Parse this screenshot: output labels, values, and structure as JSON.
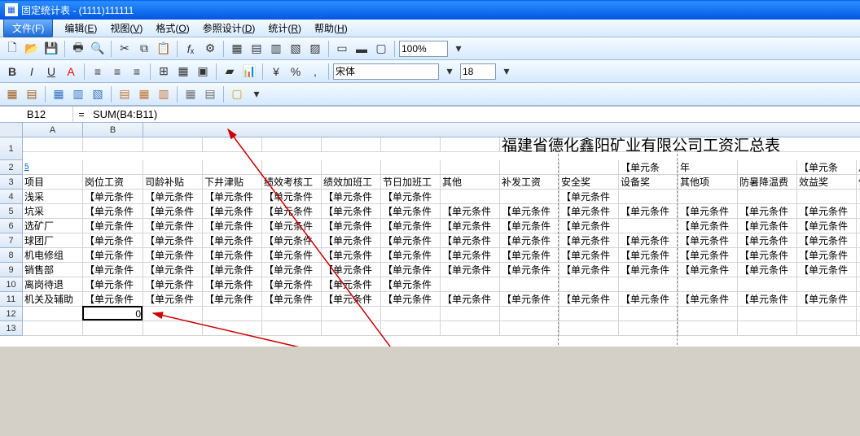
{
  "window": {
    "title": "固定统计表 - (1111)111111"
  },
  "menu": {
    "file": "文件(F)",
    "items": [
      {
        "label": "编辑",
        "key": "E"
      },
      {
        "label": "视图",
        "key": "V"
      },
      {
        "label": "格式",
        "key": "O"
      },
      {
        "label": "参照设计",
        "key": "D"
      },
      {
        "label": "统计",
        "key": "R"
      },
      {
        "label": "帮助",
        "key": "H"
      }
    ]
  },
  "formulaBar": {
    "cellRef": "B12",
    "formula": "SUM(B4:B11)"
  },
  "toolbar2": {
    "zoom": "100%",
    "font": "宋体",
    "fontSize": "18"
  },
  "sheet": {
    "colLetters": [
      "A",
      "B"
    ],
    "colWidths": {
      "A": 74,
      "B": 74,
      "rest": 73
    },
    "rowNumbers": [
      "1",
      "2",
      "3",
      "4",
      "5",
      "6",
      "7",
      "8",
      "9",
      "10",
      "11",
      "12",
      "13"
    ],
    "title": "福建省德化鑫阳矿业有限公司工资汇总表",
    "row2": {
      "K": "【单元条",
      "L": "年",
      "N": "【单元条",
      "O": "月"
    },
    "headerRow": [
      "项目",
      "岗位工资",
      "司龄补贴",
      "下井津贴",
      "绩效考核工",
      "绩效加班工",
      "节日加班工",
      "其他",
      "补发工资",
      "安全奖",
      "设备奖",
      "其他项",
      "防暑降温费",
      "效益奖",
      "停"
    ],
    "rowLabels": [
      "浅采",
      "坑采",
      "选矿厂",
      "球团厂",
      "机电修组",
      "销售部",
      "离岗待退",
      "机关及辅助"
    ],
    "placeholder": "【单元条件",
    "extraCellA2": "5",
    "b12": "0",
    "fillPattern": {
      "cols": 14,
      "blanks": {
        "4": [
          6,
          7,
          9,
          10,
          11,
          12,
          13
        ],
        "5": [
          13
        ],
        "6": [
          9
        ],
        "10": [
          6,
          7,
          8,
          9,
          10,
          11,
          12
        ],
        "11": [
          13
        ]
      }
    }
  }
}
